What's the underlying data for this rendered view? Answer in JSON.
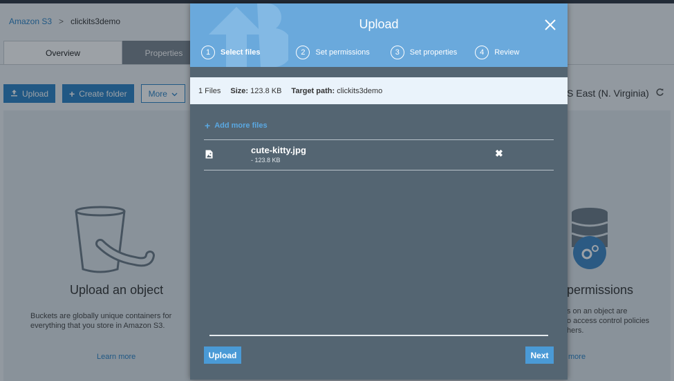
{
  "breadcrumb": {
    "root": "Amazon S3",
    "separator": ">",
    "current": "clickits3demo"
  },
  "tabs": [
    {
      "label": "Overview"
    },
    {
      "label": "Properties"
    }
  ],
  "toolbar": {
    "upload_label": "Upload",
    "create_folder_label": "Create folder",
    "more_label": "More"
  },
  "region": {
    "label": "S East (N. Virginia)"
  },
  "cards": {
    "upload": {
      "title": "Upload an object",
      "text_line1": "Buckets are globally unique containers for",
      "text_line2": "everything that you store in Amazon S3.",
      "link": "Learn more"
    },
    "permissions": {
      "title": "permissions",
      "text_line1": "s on an object are",
      "text_line2": "o access control policies",
      "text_line3": "hers.",
      "link": "more"
    }
  },
  "modal": {
    "title": "Upload",
    "steps": [
      {
        "num": "1",
        "label": "Select files"
      },
      {
        "num": "2",
        "label": "Set permissions"
      },
      {
        "num": "3",
        "label": "Set properties"
      },
      {
        "num": "4",
        "label": "Review"
      }
    ],
    "info": {
      "files": "1 Files",
      "size_label": "Size:",
      "size_value": "123.8 KB",
      "target_label": "Target path:",
      "target_value": "clickits3demo"
    },
    "add_more_label": "Add more files",
    "file": {
      "name": "cute-kitty.jpg",
      "size": "- 123.8 KB"
    },
    "upload_button": "Upload",
    "next_button": "Next"
  },
  "colors": {
    "accent": "#2b82c5",
    "modal_header": "#6aa9dc",
    "modal_body": "#546572",
    "button": "#4a9ad6"
  }
}
